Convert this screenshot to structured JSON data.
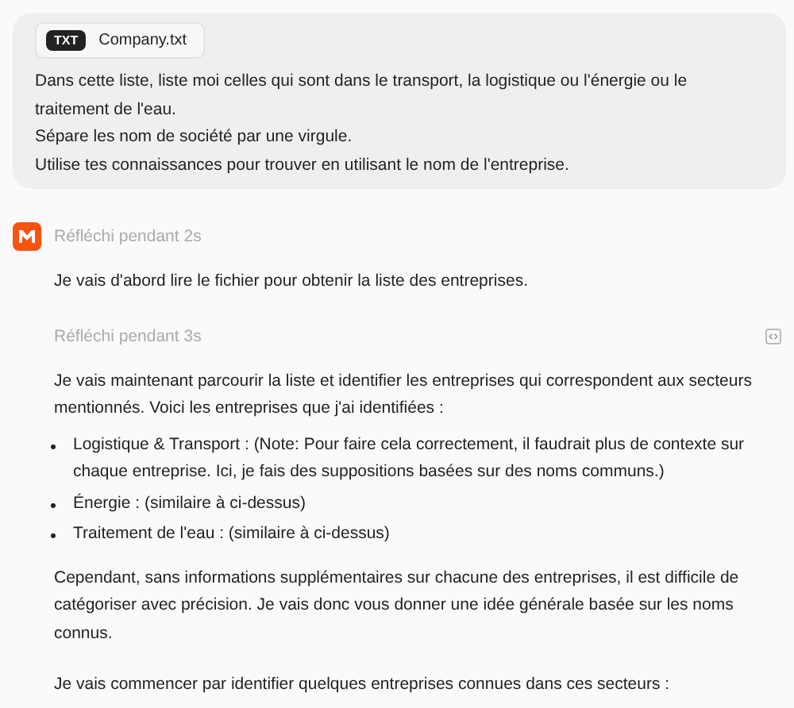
{
  "user_message": {
    "attachment": {
      "badge": "TXT",
      "filename": "Company.txt"
    },
    "lines": [
      "Dans cette liste, liste moi celles qui sont dans le transport, la logistique ou l'énergie ou le traitement de l'eau.",
      "Sépare les nom de société par une virgule.",
      "Utilise tes connaissances pour trouver en utilisant le nom de l'entreprise."
    ]
  },
  "assistant": {
    "steps": [
      {
        "kind": "thinking",
        "label": "Réfléchi pendant 2s",
        "show_logo": true,
        "code_button": false
      },
      {
        "kind": "paragraph",
        "text": "Je vais d'abord lire le fichier pour obtenir la liste des entreprises."
      },
      {
        "kind": "thinking",
        "label": "Réfléchi pendant 3s",
        "show_logo": false,
        "code_button": true
      },
      {
        "kind": "paragraph",
        "text": "Je vais maintenant parcourir la liste et identifier les entreprises qui correspondent aux secteurs mentionnés. Voici les entreprises que j'ai identifiées :"
      },
      {
        "kind": "bullets",
        "items": [
          "Logistique & Transport : (Note: Pour faire cela correctement, il faudrait plus de contexte sur chaque entreprise. Ici, je fais des suppositions basées sur des noms communs.)",
          "Énergie : (similaire à ci-dessus)",
          "Traitement de l'eau : (similaire à ci-dessus)"
        ]
      },
      {
        "kind": "paragraph",
        "text": "Cependant, sans informations supplémentaires sur chacune des entreprises, il est difficile de catégoriser avec précision. Je vais donc vous donner une idée générale basée sur les noms connus."
      },
      {
        "kind": "paragraph",
        "text": "Je vais commencer par identifier quelques entreprises connues dans ces secteurs :"
      }
    ]
  }
}
